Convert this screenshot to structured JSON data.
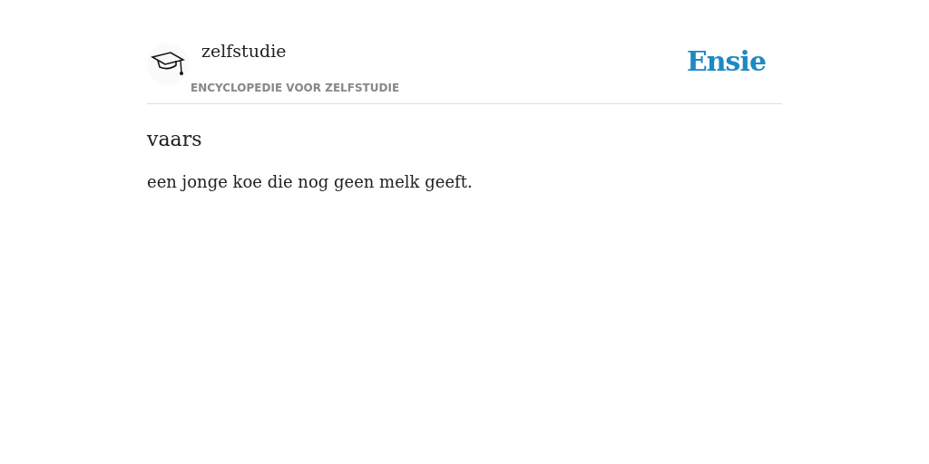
{
  "header": {
    "site_name": "zelfstudie",
    "tagline": "ENCYCLOPEDIE VOOR ZELFSTUDIE",
    "logo": "Ensie"
  },
  "entry": {
    "term": "vaars",
    "definition": "een jonge koe die nog geen melk geeft."
  }
}
